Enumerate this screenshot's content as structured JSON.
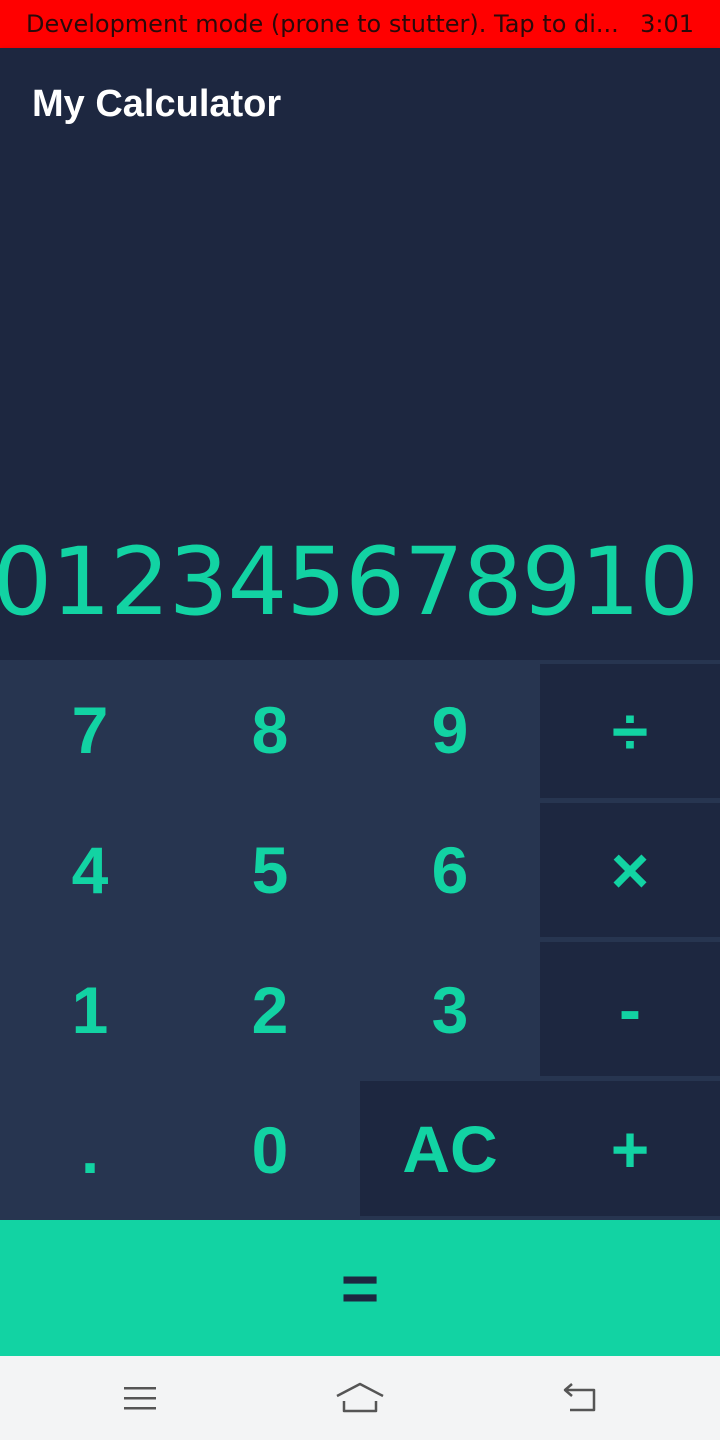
{
  "status_bar": {
    "message": "Development mode (prone to stutter). Tap to di...",
    "time": "3:01"
  },
  "app_bar": {
    "title": "My Calculator"
  },
  "display": {
    "value": "012345678910"
  },
  "keypad": {
    "key_7": "7",
    "key_8": "8",
    "key_9": "9",
    "key_divide": "÷",
    "key_4": "4",
    "key_5": "5",
    "key_6": "6",
    "key_multiply": "×",
    "key_1": "1",
    "key_2": "2",
    "key_3": "3",
    "key_minus": "-",
    "key_dot": ".",
    "key_0": "0",
    "key_ac": "AC",
    "key_plus": "+",
    "key_equals": "="
  },
  "navigation": {
    "icons": [
      "menu-icon",
      "home-icon",
      "back-icon"
    ]
  },
  "colors": {
    "accent": "#12d3a3",
    "background": "#1d2740",
    "keypad_background": "#273550",
    "status_bar": "#ff0000"
  }
}
